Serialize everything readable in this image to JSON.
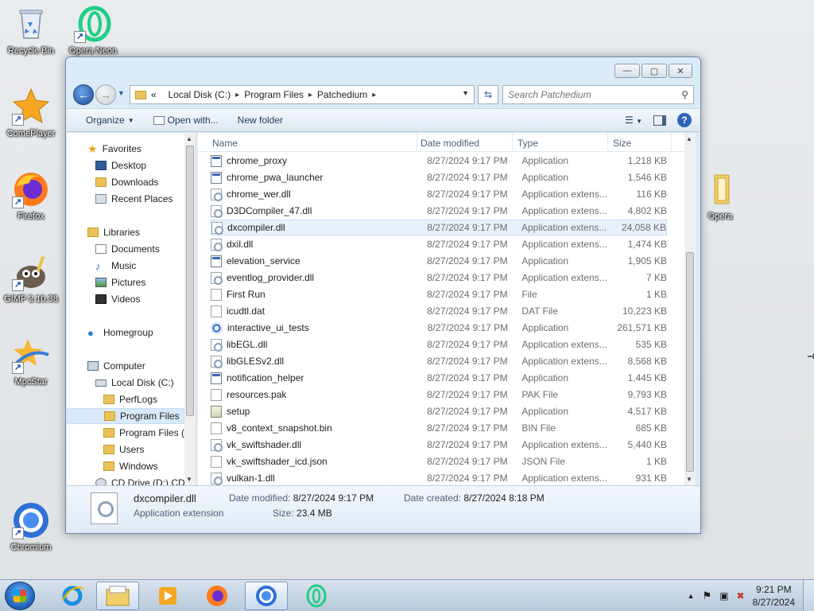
{
  "desktop": {
    "icons": [
      {
        "label": "Recycle Bin",
        "icon": "recycle-bin-icon"
      },
      {
        "label": "Opera Neon",
        "icon": "opera-neon-icon"
      },
      {
        "label": "ComePlayer",
        "icon": "comeplayer-icon"
      },
      {
        "label": "Firefox",
        "icon": "firefox-icon"
      },
      {
        "label": "GIMP 2.10.38",
        "icon": "gimp-icon"
      },
      {
        "label": "MpcStar",
        "icon": "mpcstar-icon"
      },
      {
        "label": "Chromium",
        "icon": "chromium-icon"
      },
      {
        "label": "Opera",
        "icon": "opera-folder-icon"
      }
    ]
  },
  "window": {
    "buttons": {
      "minimize": "—",
      "maximize": "▢",
      "close": "✕"
    },
    "address": {
      "prefix": "«",
      "crumbs": [
        "Local Disk (C:)",
        "Program Files",
        "Patchedium"
      ]
    },
    "search_placeholder": "Search Patchedium",
    "toolbar": {
      "organize": "Organize",
      "open_with": "Open with...",
      "new_folder": "New folder",
      "help": "?"
    },
    "nav": {
      "favorites": "Favorites",
      "desktop": "Desktop",
      "downloads": "Downloads",
      "recent": "Recent Places",
      "libraries": "Libraries",
      "documents": "Documents",
      "music": "Music",
      "pictures": "Pictures",
      "videos": "Videos",
      "homegroup": "Homegroup",
      "computer": "Computer",
      "local_disk": "Local Disk (C:)",
      "perflogs": "PerfLogs",
      "program_files": "Program Files",
      "program_files_x86": "Program Files (",
      "users": "Users",
      "windows": "Windows",
      "cd_drive": "CD Drive (D:) CD"
    },
    "columns": {
      "name": "Name",
      "date": "Date modified",
      "type": "Type",
      "size": "Size"
    },
    "files": [
      {
        "name": "chrome_proxy",
        "date": "8/27/2024 9:17 PM",
        "type": "Application",
        "size": "1,218 KB",
        "icon": "app"
      },
      {
        "name": "chrome_pwa_launcher",
        "date": "8/27/2024 9:17 PM",
        "type": "Application",
        "size": "1,546 KB",
        "icon": "app"
      },
      {
        "name": "chrome_wer.dll",
        "date": "8/27/2024 9:17 PM",
        "type": "Application extens...",
        "size": "116 KB",
        "icon": "dll"
      },
      {
        "name": "D3DCompiler_47.dll",
        "date": "8/27/2024 9:17 PM",
        "type": "Application extens...",
        "size": "4,802 KB",
        "icon": "dll"
      },
      {
        "name": "dxcompiler.dll",
        "date": "8/27/2024 9:17 PM",
        "type": "Application extens...",
        "size": "24,058 KB",
        "icon": "dll"
      },
      {
        "name": "dxil.dll",
        "date": "8/27/2024 9:17 PM",
        "type": "Application extens...",
        "size": "1,474 KB",
        "icon": "dll"
      },
      {
        "name": "elevation_service",
        "date": "8/27/2024 9:17 PM",
        "type": "Application",
        "size": "1,905 KB",
        "icon": "app"
      },
      {
        "name": "eventlog_provider.dll",
        "date": "8/27/2024 9:17 PM",
        "type": "Application extens...",
        "size": "7 KB",
        "icon": "dll"
      },
      {
        "name": "First Run",
        "date": "8/27/2024 9:17 PM",
        "type": "File",
        "size": "1 KB",
        "icon": "file"
      },
      {
        "name": "icudtl.dat",
        "date": "8/27/2024 9:17 PM",
        "type": "DAT File",
        "size": "10,223 KB",
        "icon": "file"
      },
      {
        "name": "interactive_ui_tests",
        "date": "8/27/2024 9:17 PM",
        "type": "Application",
        "size": "261,571 KB",
        "icon": "chrome"
      },
      {
        "name": "libEGL.dll",
        "date": "8/27/2024 9:17 PM",
        "type": "Application extens...",
        "size": "535 KB",
        "icon": "dll"
      },
      {
        "name": "libGLESv2.dll",
        "date": "8/27/2024 9:17 PM",
        "type": "Application extens...",
        "size": "8,568 KB",
        "icon": "dll"
      },
      {
        "name": "notification_helper",
        "date": "8/27/2024 9:17 PM",
        "type": "Application",
        "size": "1,445 KB",
        "icon": "app"
      },
      {
        "name": "resources.pak",
        "date": "8/27/2024 9:17 PM",
        "type": "PAK File",
        "size": "9,793 KB",
        "icon": "file"
      },
      {
        "name": "setup",
        "date": "8/27/2024 9:17 PM",
        "type": "Application",
        "size": "4,517 KB",
        "icon": "setup"
      },
      {
        "name": "v8_context_snapshot.bin",
        "date": "8/27/2024 9:17 PM",
        "type": "BIN File",
        "size": "685 KB",
        "icon": "file"
      },
      {
        "name": "vk_swiftshader.dll",
        "date": "8/27/2024 9:17 PM",
        "type": "Application extens...",
        "size": "5,440 KB",
        "icon": "dll"
      },
      {
        "name": "vk_swiftshader_icd.json",
        "date": "8/27/2024 9:17 PM",
        "type": "JSON File",
        "size": "1 KB",
        "icon": "file"
      },
      {
        "name": "vulkan-1.dll",
        "date": "8/27/2024 9:17 PM",
        "type": "Application extens...",
        "size": "931 KB",
        "icon": "dll"
      }
    ],
    "selected_file": "dxcompiler.dll",
    "details": {
      "name": "dxcompiler.dll",
      "type": "Application extension",
      "modified_label": "Date modified:",
      "modified": "8/27/2024 9:17 PM",
      "created_label": "Date created:",
      "created": "8/27/2024 8:18 PM",
      "size_label": "Size:",
      "size": "23.4 MB"
    }
  },
  "taskbar": {
    "pinned": [
      "start-orb",
      "internet-explorer-icon",
      "windows-explorer-icon",
      "media-player-icon",
      "firefox-icon",
      "chromium-icon",
      "opera-neon-icon"
    ],
    "clock": {
      "time": "9:21 PM",
      "date": "8/27/2024"
    }
  },
  "colors": {
    "window_frame": "#dcebf8",
    "selection": "#d9e9fa",
    "taskbar": "#b7c9da"
  }
}
